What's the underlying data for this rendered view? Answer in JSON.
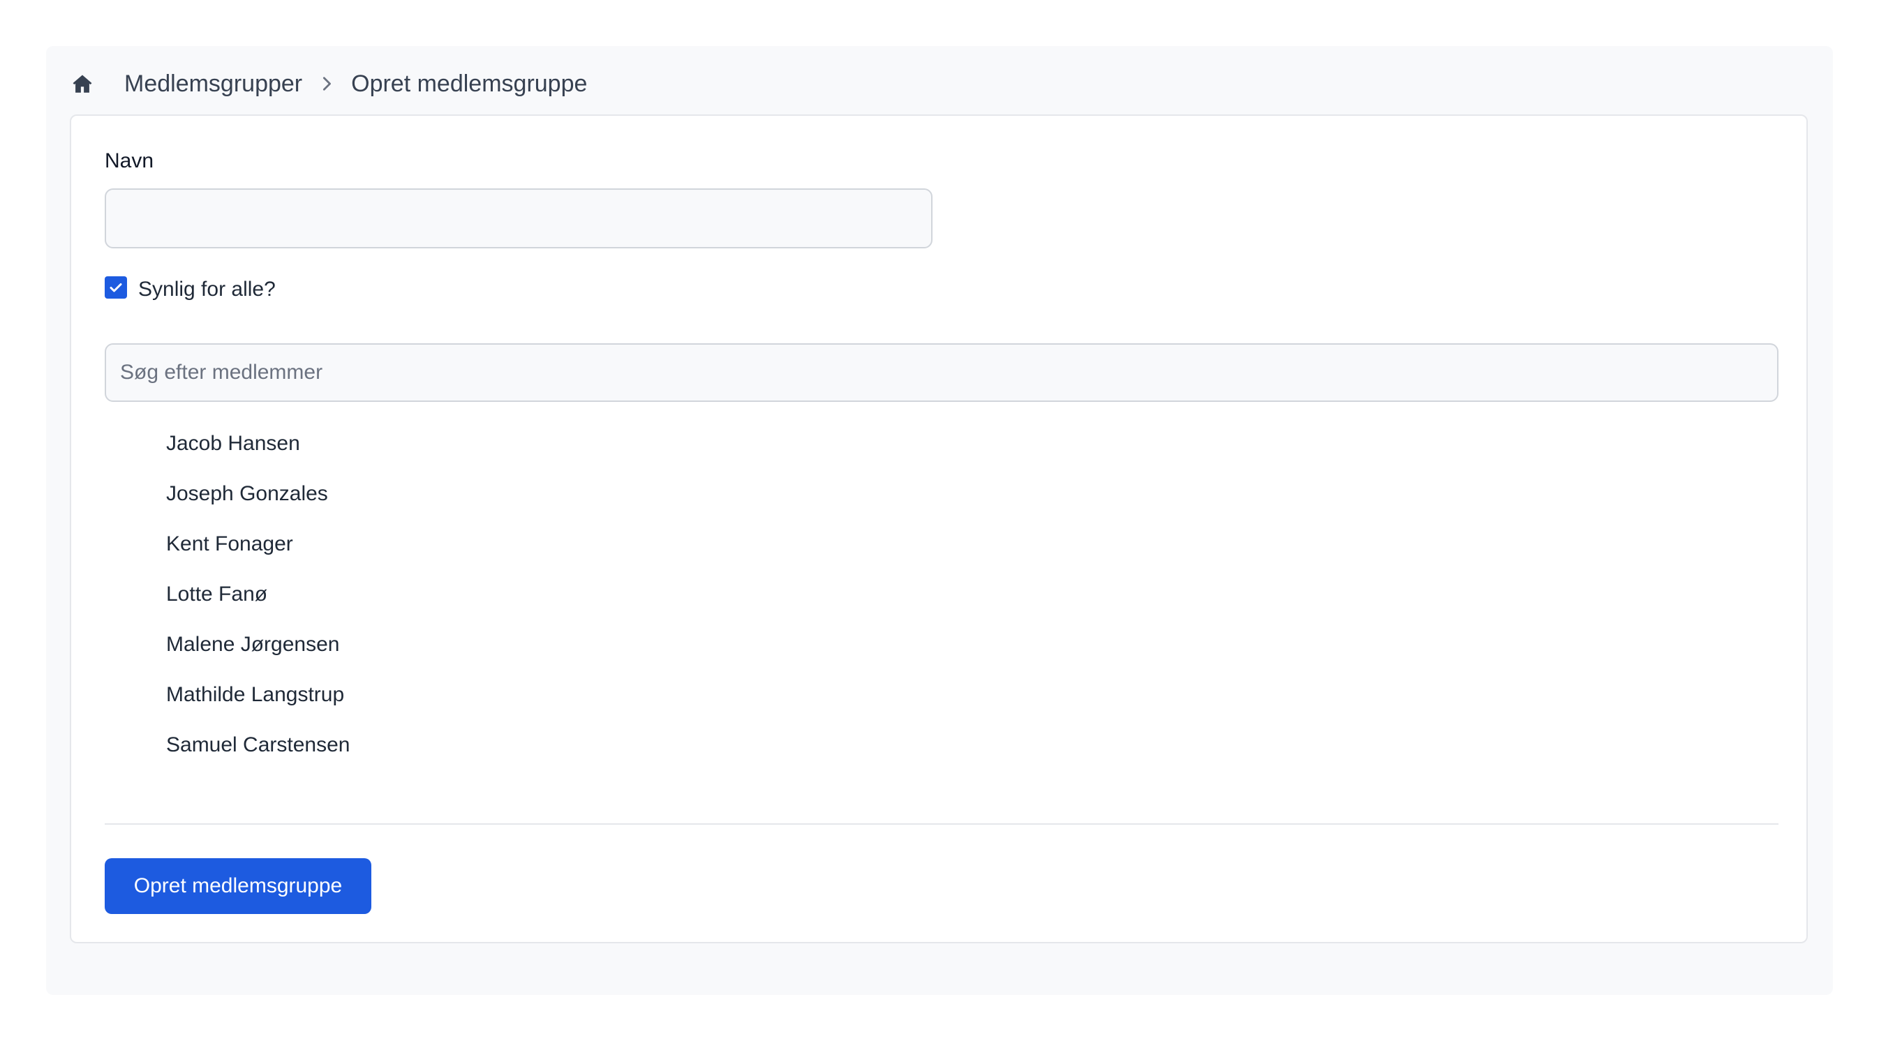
{
  "breadcrumb": {
    "home_icon": "home-icon",
    "items": [
      "Medlemsgrupper",
      "Opret medlemsgruppe"
    ]
  },
  "form": {
    "name_label": "Navn",
    "name_value": "",
    "visible_label": "Synlig for alle?",
    "visible_checked": true,
    "search_placeholder": "Søg efter medlemmer",
    "search_value": "",
    "members": [
      "Jacob Hansen",
      "Joseph Gonzales",
      "Kent Fonager",
      "Lotte Fanø",
      "Malene Jørgensen",
      "Mathilde Langstrup",
      "Samuel Carstensen"
    ],
    "submit_label": "Opret medlemsgruppe"
  },
  "colors": {
    "accent": "#1d5be0",
    "page_bg": "#f8f9fb",
    "card_border": "#e5e7eb",
    "text": "#1f2937"
  }
}
